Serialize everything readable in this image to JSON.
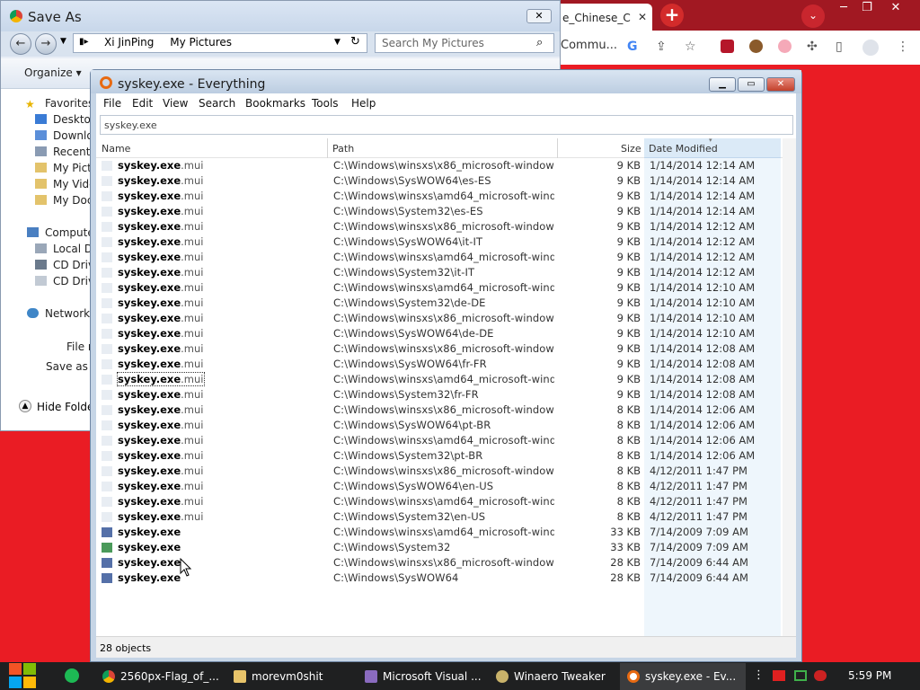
{
  "browser": {
    "tab_title": "e_Chinese_C",
    "tab_close": "✕",
    "new_tab": "+",
    "toolbar_text": "Commu...",
    "window_minimize": "─",
    "window_restore": "❐",
    "window_close": "✕"
  },
  "save_as": {
    "title": "Save As",
    "close": "✕",
    "path": [
      "Xi JinPing",
      "My Pictures"
    ],
    "search_placeholder": "Search My Pictures",
    "organize": "Organize ▾",
    "tree": [
      {
        "label": "Favorites",
        "icon": "star-icon"
      },
      {
        "label": "Desktop",
        "icon": "desktop-icon"
      },
      {
        "label": "Downlo",
        "icon": "downloads-icon"
      },
      {
        "label": "Recent",
        "icon": "recent-icon"
      },
      {
        "label": "My Pict",
        "icon": "pictures-icon"
      },
      {
        "label": "My Vide",
        "icon": "videos-icon"
      },
      {
        "label": "My Doc",
        "icon": "documents-icon"
      },
      {
        "label": "Computer",
        "icon": "computer-icon"
      },
      {
        "label": "Local D",
        "icon": "drive-icon"
      },
      {
        "label": "CD Driv",
        "icon": "cd-drive-icon"
      },
      {
        "label": "CD Driv",
        "icon": "cd-drive-icon"
      },
      {
        "label": "Network",
        "icon": "network-icon"
      }
    ],
    "file_name_label": "File n",
    "save_as_type_label": "Save as",
    "hide_folders": "Hide Folder"
  },
  "everything": {
    "title": "syskey.exe - Everything",
    "menu": [
      "File",
      "Edit",
      "View",
      "Search",
      "Bookmarks",
      "Tools",
      "Help"
    ],
    "search_value": "syskey.exe",
    "columns": {
      "name": "Name",
      "path": "Path",
      "size": "Size",
      "date": "Date Modified"
    },
    "rows": [
      {
        "name": "syskey.exe",
        "ext": ".mui",
        "path": "C:\\Windows\\winsxs\\x86_microsoft-window...",
        "size": "9 KB",
        "date": "1/14/2014 12:14 AM"
      },
      {
        "name": "syskey.exe",
        "ext": ".mui",
        "path": "C:\\Windows\\SysWOW64\\es-ES",
        "size": "9 KB",
        "date": "1/14/2014 12:14 AM"
      },
      {
        "name": "syskey.exe",
        "ext": ".mui",
        "path": "C:\\Windows\\winsxs\\amd64_microsoft-wind...",
        "size": "9 KB",
        "date": "1/14/2014 12:14 AM"
      },
      {
        "name": "syskey.exe",
        "ext": ".mui",
        "path": "C:\\Windows\\System32\\es-ES",
        "size": "9 KB",
        "date": "1/14/2014 12:14 AM"
      },
      {
        "name": "syskey.exe",
        "ext": ".mui",
        "path": "C:\\Windows\\winsxs\\x86_microsoft-window...",
        "size": "9 KB",
        "date": "1/14/2014 12:12 AM"
      },
      {
        "name": "syskey.exe",
        "ext": ".mui",
        "path": "C:\\Windows\\SysWOW64\\it-IT",
        "size": "9 KB",
        "date": "1/14/2014 12:12 AM"
      },
      {
        "name": "syskey.exe",
        "ext": ".mui",
        "path": "C:\\Windows\\winsxs\\amd64_microsoft-wind...",
        "size": "9 KB",
        "date": "1/14/2014 12:12 AM"
      },
      {
        "name": "syskey.exe",
        "ext": ".mui",
        "path": "C:\\Windows\\System32\\it-IT",
        "size": "9 KB",
        "date": "1/14/2014 12:12 AM"
      },
      {
        "name": "syskey.exe",
        "ext": ".mui",
        "path": "C:\\Windows\\winsxs\\amd64_microsoft-wind...",
        "size": "9 KB",
        "date": "1/14/2014 12:10 AM"
      },
      {
        "name": "syskey.exe",
        "ext": ".mui",
        "path": "C:\\Windows\\System32\\de-DE",
        "size": "9 KB",
        "date": "1/14/2014 12:10 AM"
      },
      {
        "name": "syskey.exe",
        "ext": ".mui",
        "path": "C:\\Windows\\winsxs\\x86_microsoft-window...",
        "size": "9 KB",
        "date": "1/14/2014 12:10 AM"
      },
      {
        "name": "syskey.exe",
        "ext": ".mui",
        "path": "C:\\Windows\\SysWOW64\\de-DE",
        "size": "9 KB",
        "date": "1/14/2014 12:10 AM"
      },
      {
        "name": "syskey.exe",
        "ext": ".mui",
        "path": "C:\\Windows\\winsxs\\x86_microsoft-window...",
        "size": "9 KB",
        "date": "1/14/2014 12:08 AM"
      },
      {
        "name": "syskey.exe",
        "ext": ".mui",
        "path": "C:\\Windows\\SysWOW64\\fr-FR",
        "size": "9 KB",
        "date": "1/14/2014 12:08 AM"
      },
      {
        "name": "syskey.exe",
        "ext": ".mui",
        "path": "C:\\Windows\\winsxs\\amd64_microsoft-wind...",
        "size": "9 KB",
        "date": "1/14/2014 12:08 AM",
        "focused": true
      },
      {
        "name": "syskey.exe",
        "ext": ".mui",
        "path": "C:\\Windows\\System32\\fr-FR",
        "size": "9 KB",
        "date": "1/14/2014 12:08 AM"
      },
      {
        "name": "syskey.exe",
        "ext": ".mui",
        "path": "C:\\Windows\\winsxs\\x86_microsoft-window...",
        "size": "8 KB",
        "date": "1/14/2014 12:06 AM"
      },
      {
        "name": "syskey.exe",
        "ext": ".mui",
        "path": "C:\\Windows\\SysWOW64\\pt-BR",
        "size": "8 KB",
        "date": "1/14/2014 12:06 AM"
      },
      {
        "name": "syskey.exe",
        "ext": ".mui",
        "path": "C:\\Windows\\winsxs\\amd64_microsoft-wind...",
        "size": "8 KB",
        "date": "1/14/2014 12:06 AM"
      },
      {
        "name": "syskey.exe",
        "ext": ".mui",
        "path": "C:\\Windows\\System32\\pt-BR",
        "size": "8 KB",
        "date": "1/14/2014 12:06 AM"
      },
      {
        "name": "syskey.exe",
        "ext": ".mui",
        "path": "C:\\Windows\\winsxs\\x86_microsoft-window...",
        "size": "8 KB",
        "date": "4/12/2011 1:47 PM"
      },
      {
        "name": "syskey.exe",
        "ext": ".mui",
        "path": "C:\\Windows\\SysWOW64\\en-US",
        "size": "8 KB",
        "date": "4/12/2011 1:47 PM"
      },
      {
        "name": "syskey.exe",
        "ext": ".mui",
        "path": "C:\\Windows\\winsxs\\amd64_microsoft-wind...",
        "size": "8 KB",
        "date": "4/12/2011 1:47 PM"
      },
      {
        "name": "syskey.exe",
        "ext": ".mui",
        "path": "C:\\Windows\\System32\\en-US",
        "size": "8 KB",
        "date": "4/12/2011 1:47 PM"
      },
      {
        "name": "syskey.exe",
        "ext": "",
        "path": "C:\\Windows\\winsxs\\amd64_microsoft-wind...",
        "size": "33 KB",
        "date": "7/14/2009 7:09 AM",
        "exe": true
      },
      {
        "name": "syskey.exe",
        "ext": "",
        "path": "C:\\Windows\\System32",
        "size": "33 KB",
        "date": "7/14/2009 7:09 AM",
        "exe": true
      },
      {
        "name": "syskey.exe",
        "ext": "",
        "path": "C:\\Windows\\winsxs\\x86_microsoft-window...",
        "size": "28 KB",
        "date": "7/14/2009 6:44 AM",
        "exe": true
      },
      {
        "name": "syskey.exe",
        "ext": "",
        "path": "C:\\Windows\\SysWOW64",
        "size": "28 KB",
        "date": "7/14/2009 6:44 AM",
        "exe": true
      }
    ],
    "status": "28 objects"
  },
  "taskbar": {
    "items": [
      {
        "label": "2560px-Flag_of_...",
        "icon": "chrome-icon"
      },
      {
        "label": "morevm0shit",
        "icon": "folder-icon"
      },
      {
        "label": "Microsoft Visual ...",
        "icon": "visual-studio-icon"
      },
      {
        "label": "Winaero Tweaker",
        "icon": "winaero-icon"
      },
      {
        "label": "syskey.exe - Ev...",
        "icon": "everything-icon"
      }
    ],
    "clock": "5:59 PM"
  },
  "colors": {
    "desktop": "#ea1c24",
    "browser": "#a11822",
    "selection": "#dbeaf7"
  }
}
